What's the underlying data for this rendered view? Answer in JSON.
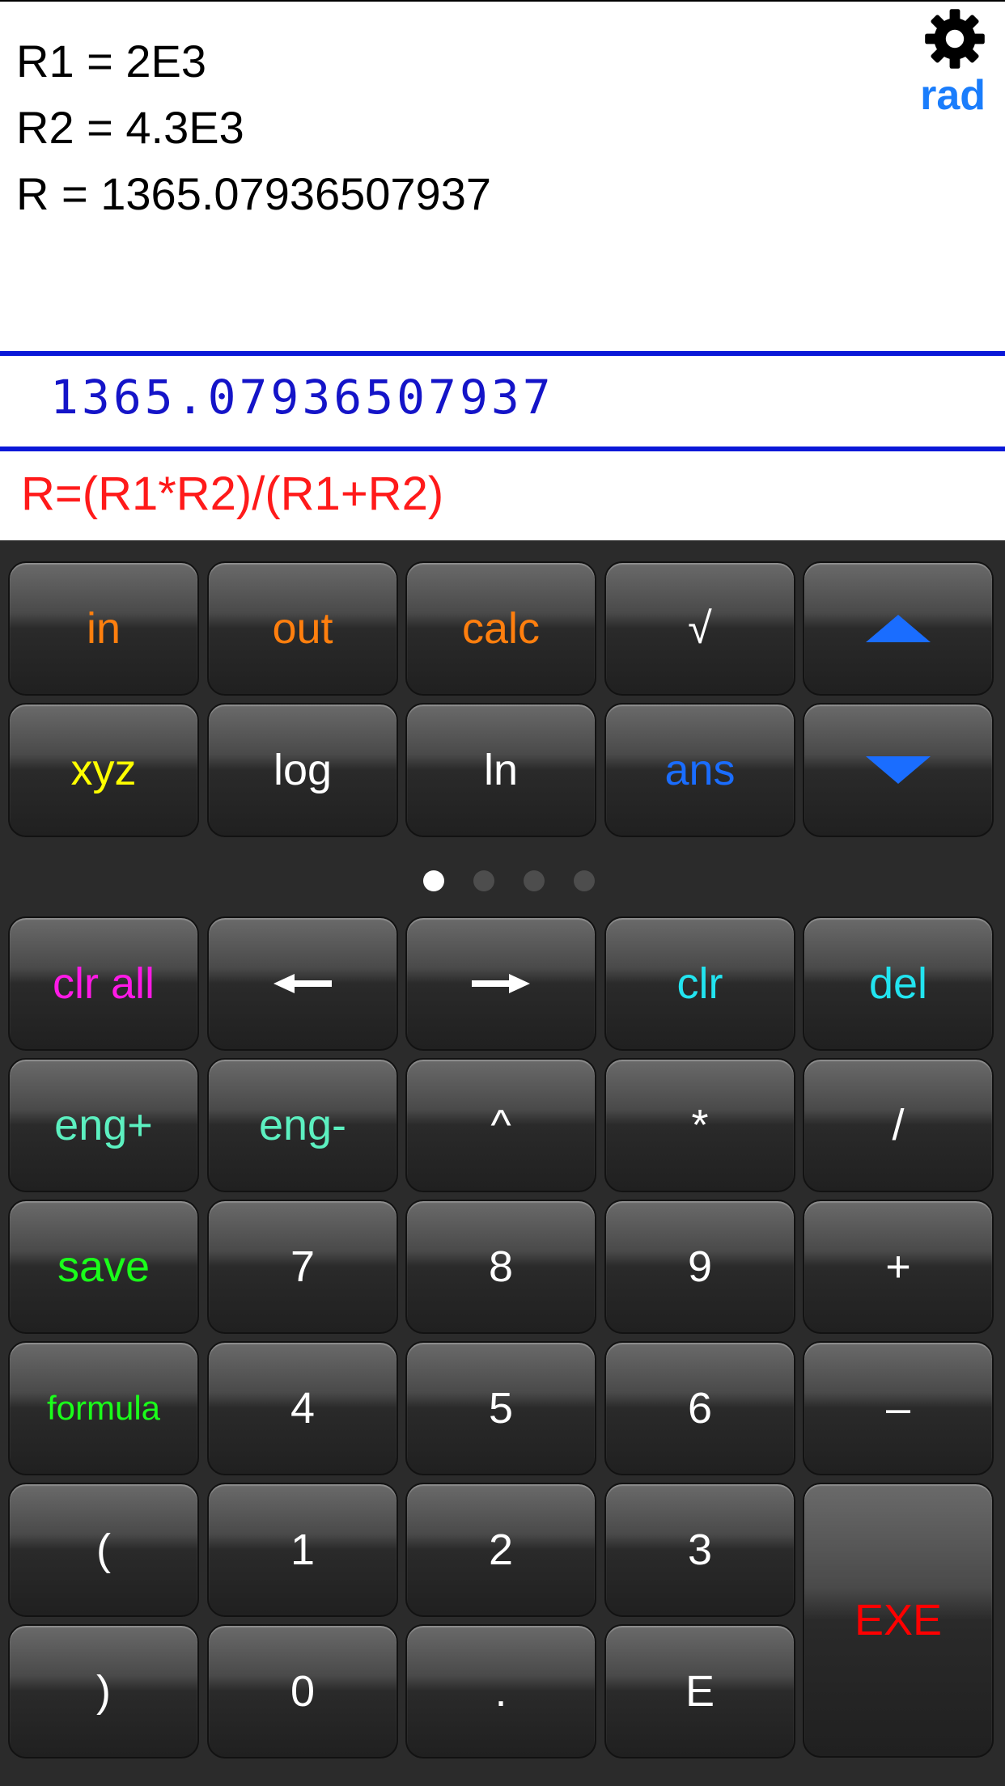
{
  "history": {
    "lines": [
      "R1 = 2E3",
      "R2 = 4.3E3",
      "R = 1365.07936507937"
    ],
    "mode": "rad"
  },
  "result": "1365.07936507937",
  "input": "R=(R1*R2)/(R1+R2)",
  "colors": {
    "orange": "#ff7f0e",
    "white": "#ffffff",
    "blue": "#1a6dff",
    "yellow": "#ffff00",
    "magenta": "#ff1ae6",
    "cyan": "#22e4f0",
    "mint": "#5cf0c0",
    "green": "#1aff1a",
    "red": "#ff0000"
  },
  "keys": {
    "in": "in",
    "out": "out",
    "calc": "calc",
    "sqrt": "√",
    "xyz": "xyz",
    "log": "log",
    "ln": "ln",
    "ans": "ans",
    "clr_all": "clr all",
    "clr": "clr",
    "del": "del",
    "eng_plus": "eng+",
    "eng_minus": "eng-",
    "power": "^",
    "multiply": "*",
    "divide": "/",
    "save": "save",
    "seven": "7",
    "eight": "8",
    "nine": "9",
    "plus": "+",
    "formula": "formula",
    "four": "4",
    "five": "5",
    "six": "6",
    "minus": "–",
    "open_paren": "(",
    "one": "1",
    "two": "2",
    "three": "3",
    "exe": "EXE",
    "close_paren": ")",
    "zero": "0",
    "dot": ".",
    "exp": "E"
  },
  "icons": {
    "settings": "gear-icon",
    "up": "triangle-up-icon",
    "down": "triangle-down-icon",
    "left": "arrow-left-icon",
    "right": "arrow-right-icon"
  },
  "page_indicator": {
    "count": 4,
    "active": 1
  }
}
